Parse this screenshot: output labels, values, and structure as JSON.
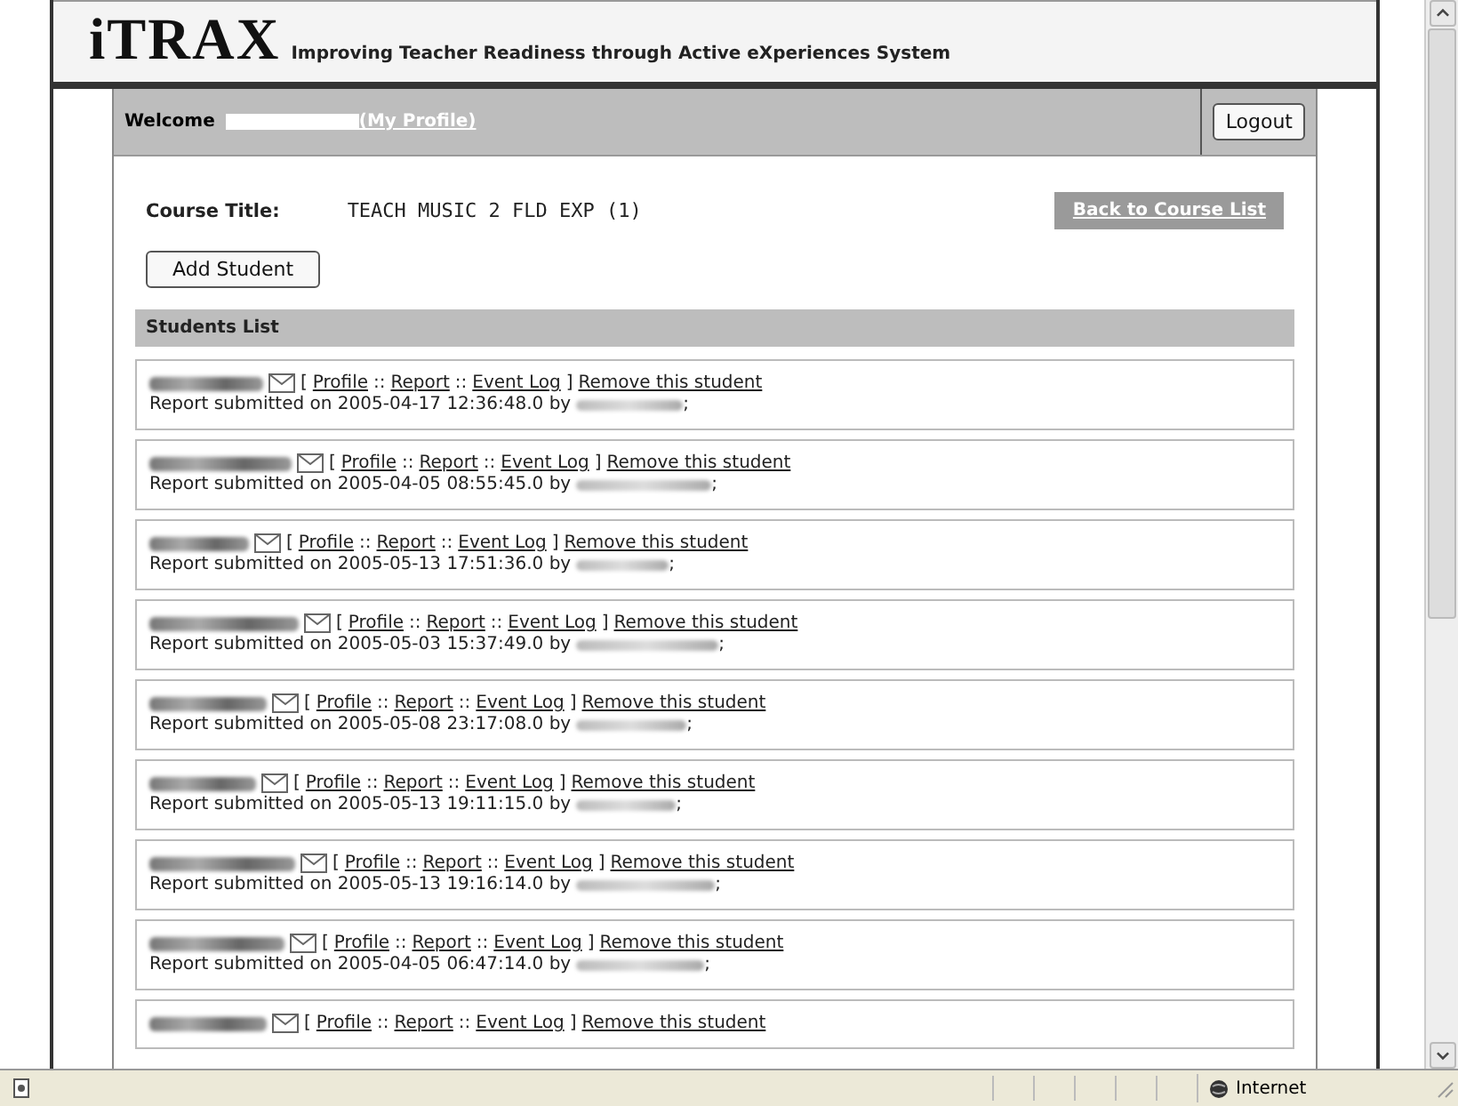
{
  "header": {
    "logo": "iTRAX",
    "tagline": "Improving Teacher Readiness through Active eXperiences System"
  },
  "welcome": {
    "label": "Welcome",
    "profile_link": "(My Profile)",
    "logout": "Logout"
  },
  "course": {
    "label": "Course Title:",
    "title": "TEACH MUSIC 2 FLD EXP (1)",
    "back_link": "Back to Course List"
  },
  "add_button": "Add Student",
  "list_title": "Students List",
  "students": [
    {
      "actions": [
        {
          "kind": "sep",
          "text": "["
        },
        {
          "kind": "link",
          "text": "Profile"
        },
        {
          "kind": "sep",
          "text": "::"
        },
        {
          "kind": "link",
          "text": "Report"
        },
        {
          "kind": "sep",
          "text": "::"
        },
        {
          "kind": "link",
          "text": "Event Log"
        },
        {
          "kind": "sep",
          "text": "]"
        },
        {
          "kind": "link",
          "text": "Remove this student"
        }
      ],
      "report": "Report submitted on 2005-04-17 12:36:48.0 by",
      "report_end": ";"
    },
    {
      "actions": [
        {
          "kind": "sep",
          "text": "["
        },
        {
          "kind": "link",
          "text": "Profile"
        },
        {
          "kind": "sep",
          "text": "::"
        },
        {
          "kind": "link",
          "text": "Report"
        },
        {
          "kind": "sep",
          "text": "::"
        },
        {
          "kind": "link",
          "text": "Event Log"
        },
        {
          "kind": "sep",
          "text": "]"
        },
        {
          "kind": "link",
          "text": "Remove this student"
        }
      ],
      "report": "Report submitted on 2005-04-05 08:55:45.0 by",
      "report_end": ";"
    },
    {
      "actions": [
        {
          "kind": "sep",
          "text": "["
        },
        {
          "kind": "link",
          "text": "Profile"
        },
        {
          "kind": "sep",
          "text": "::"
        },
        {
          "kind": "link",
          "text": "Report"
        },
        {
          "kind": "sep",
          "text": "::"
        },
        {
          "kind": "link",
          "text": "Event Log"
        },
        {
          "kind": "sep",
          "text": "]"
        },
        {
          "kind": "link",
          "text": "Remove this student"
        }
      ],
      "report": "Report submitted on 2005-05-13 17:51:36.0 by",
      "report_end": ";"
    },
    {
      "actions": [
        {
          "kind": "sep",
          "text": "["
        },
        {
          "kind": "link",
          "text": "Profile"
        },
        {
          "kind": "sep",
          "text": "::"
        },
        {
          "kind": "link",
          "text": "Report"
        },
        {
          "kind": "sep",
          "text": "::"
        },
        {
          "kind": "link",
          "text": "Event Log"
        },
        {
          "kind": "sep",
          "text": "]"
        },
        {
          "kind": "link",
          "text": "Remove this student"
        }
      ],
      "report": "Report submitted on 2005-05-03 15:37:49.0 by",
      "report_end": ";"
    },
    {
      "actions": [
        {
          "kind": "sep",
          "text": "["
        },
        {
          "kind": "link",
          "text": "Profile"
        },
        {
          "kind": "sep",
          "text": "::"
        },
        {
          "kind": "link",
          "text": "Report"
        },
        {
          "kind": "sep",
          "text": "::"
        },
        {
          "kind": "link",
          "text": "Event Log"
        },
        {
          "kind": "sep",
          "text": "]"
        },
        {
          "kind": "link",
          "text": "Remove this student"
        }
      ],
      "report": "Report submitted on 2005-05-08 23:17:08.0 by",
      "report_end": ";"
    },
    {
      "actions": [
        {
          "kind": "sep",
          "text": "["
        },
        {
          "kind": "link",
          "text": "Profile"
        },
        {
          "kind": "sep",
          "text": "::"
        },
        {
          "kind": "link",
          "text": "Report"
        },
        {
          "kind": "sep",
          "text": "::"
        },
        {
          "kind": "link",
          "text": "Event Log"
        },
        {
          "kind": "sep",
          "text": "]"
        },
        {
          "kind": "link",
          "text": "Remove this student"
        }
      ],
      "report": "Report submitted on 2005-05-13 19:11:15.0 by",
      "report_end": ";"
    },
    {
      "actions": [
        {
          "kind": "sep",
          "text": "["
        },
        {
          "kind": "link",
          "text": "Profile"
        },
        {
          "kind": "sep",
          "text": "::"
        },
        {
          "kind": "link",
          "text": "Report"
        },
        {
          "kind": "sep",
          "text": "::"
        },
        {
          "kind": "link",
          "text": "Event Log"
        },
        {
          "kind": "sep",
          "text": "]"
        },
        {
          "kind": "link",
          "text": "Remove this student"
        }
      ],
      "report": "Report submitted on 2005-05-13 19:16:14.0 by",
      "report_end": ";"
    },
    {
      "actions": [
        {
          "kind": "sep",
          "text": "["
        },
        {
          "kind": "link",
          "text": "Profile"
        },
        {
          "kind": "sep",
          "text": "::"
        },
        {
          "kind": "link",
          "text": "Report"
        },
        {
          "kind": "sep",
          "text": "::"
        },
        {
          "kind": "link",
          "text": "Event Log"
        },
        {
          "kind": "sep",
          "text": "]"
        },
        {
          "kind": "link",
          "text": "Remove this student"
        }
      ],
      "report": "Report submitted on 2005-04-05 06:47:14.0 by",
      "report_end": ";"
    },
    {
      "actions": [
        {
          "kind": "sep",
          "text": "["
        },
        {
          "kind": "link",
          "text": "Profile"
        },
        {
          "kind": "sep",
          "text": "::"
        },
        {
          "kind": "link",
          "text": "Report"
        },
        {
          "kind": "sep",
          "text": "::"
        },
        {
          "kind": "link",
          "text": "Event Log"
        },
        {
          "kind": "sep",
          "text": "]"
        },
        {
          "kind": "link",
          "text": "Remove this student"
        }
      ]
    }
  ],
  "status_bar": {
    "zone": "Internet"
  }
}
